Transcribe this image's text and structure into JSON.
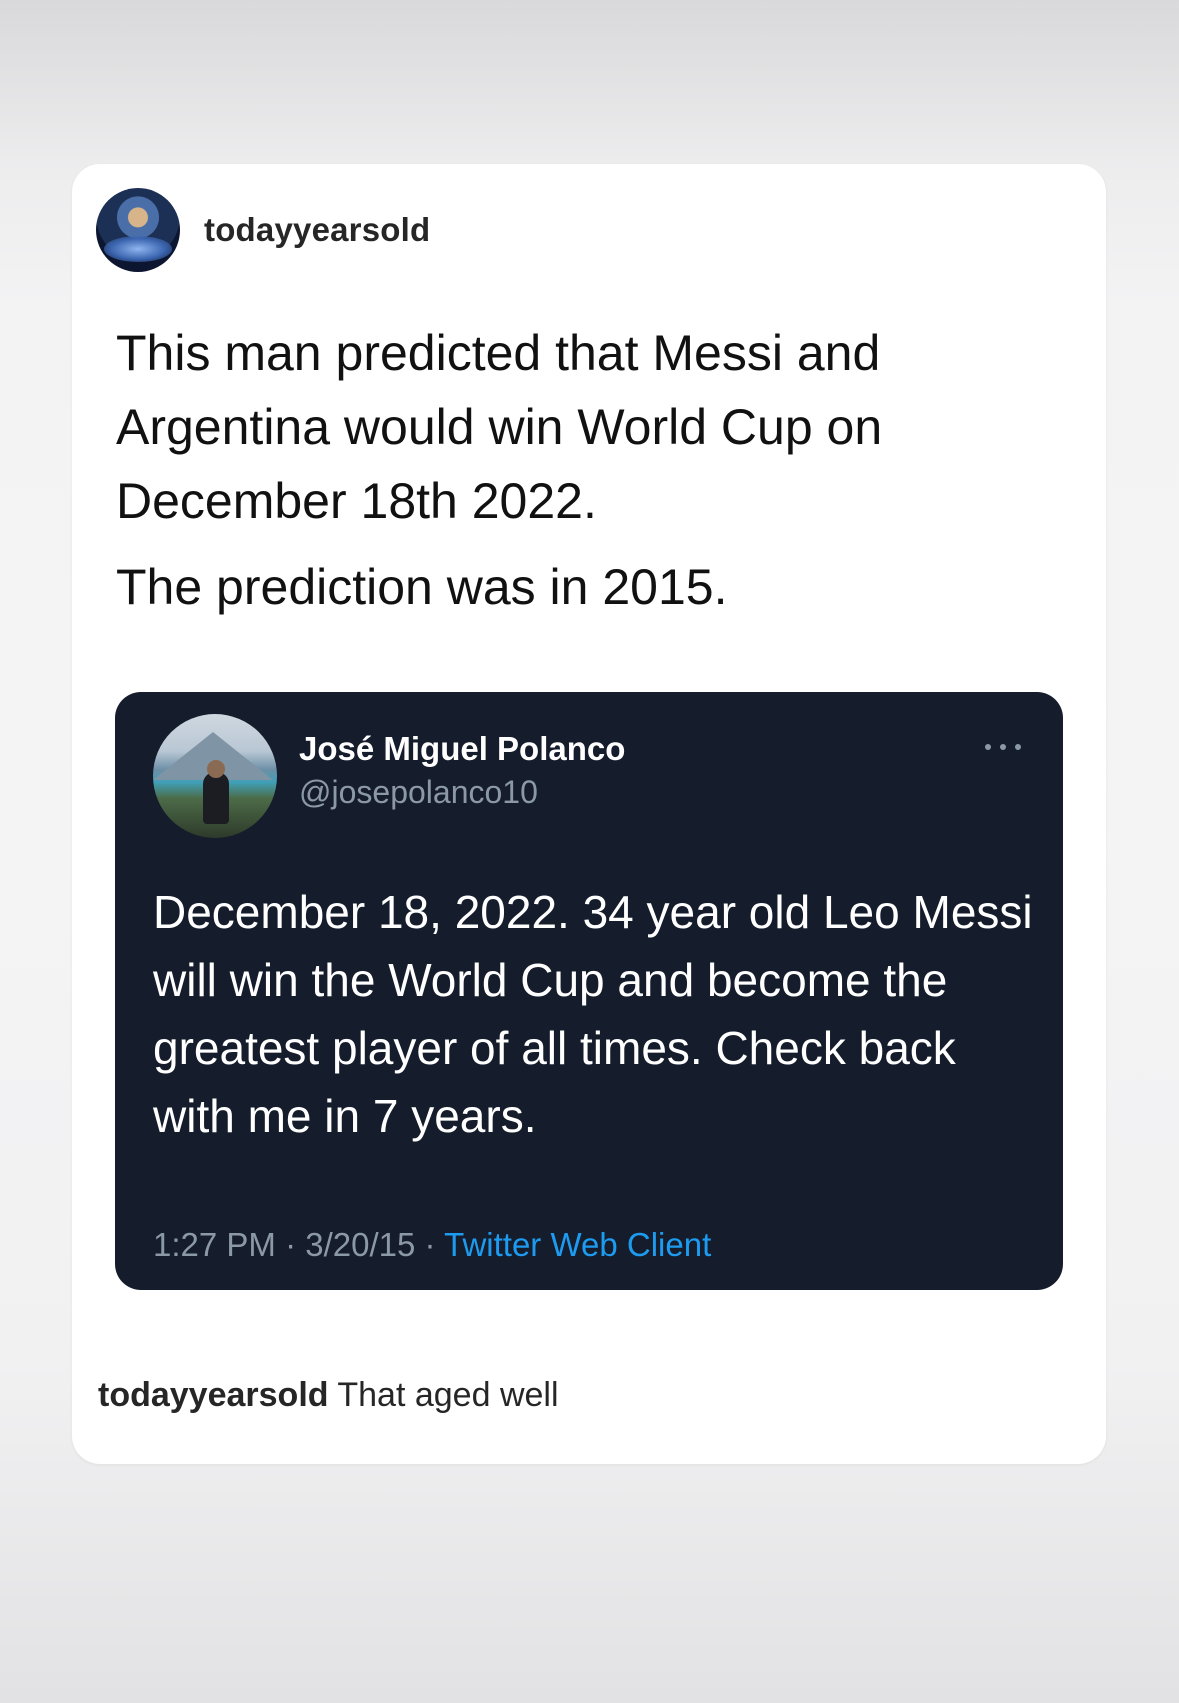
{
  "post": {
    "username": "todayyearsold",
    "caption_line1": "This man predicted that Messi and Argentina would win World Cup on December 18th 2022.",
    "caption_line2": "The prediction was in 2015."
  },
  "tweet": {
    "name": "José Miguel Polanco",
    "handle": "@josepolanco10",
    "text": "December 18, 2022. 34 year old Leo Messi will win the World Cup and become the greatest player of all times. Check back with me in 7 years.",
    "time": "1:27 PM",
    "date": "3/20/15",
    "separator": "·",
    "client": "Twitter Web Client"
  },
  "comment": {
    "username": "todayyearsold",
    "text": "That aged well"
  },
  "icons": {
    "more": "more-horizontal-icon",
    "avatar": "profile-avatar"
  },
  "colors": {
    "tweet_background": "#151c2b",
    "link_blue": "#1d9bf0",
    "muted_gray": "#8b98a5"
  }
}
